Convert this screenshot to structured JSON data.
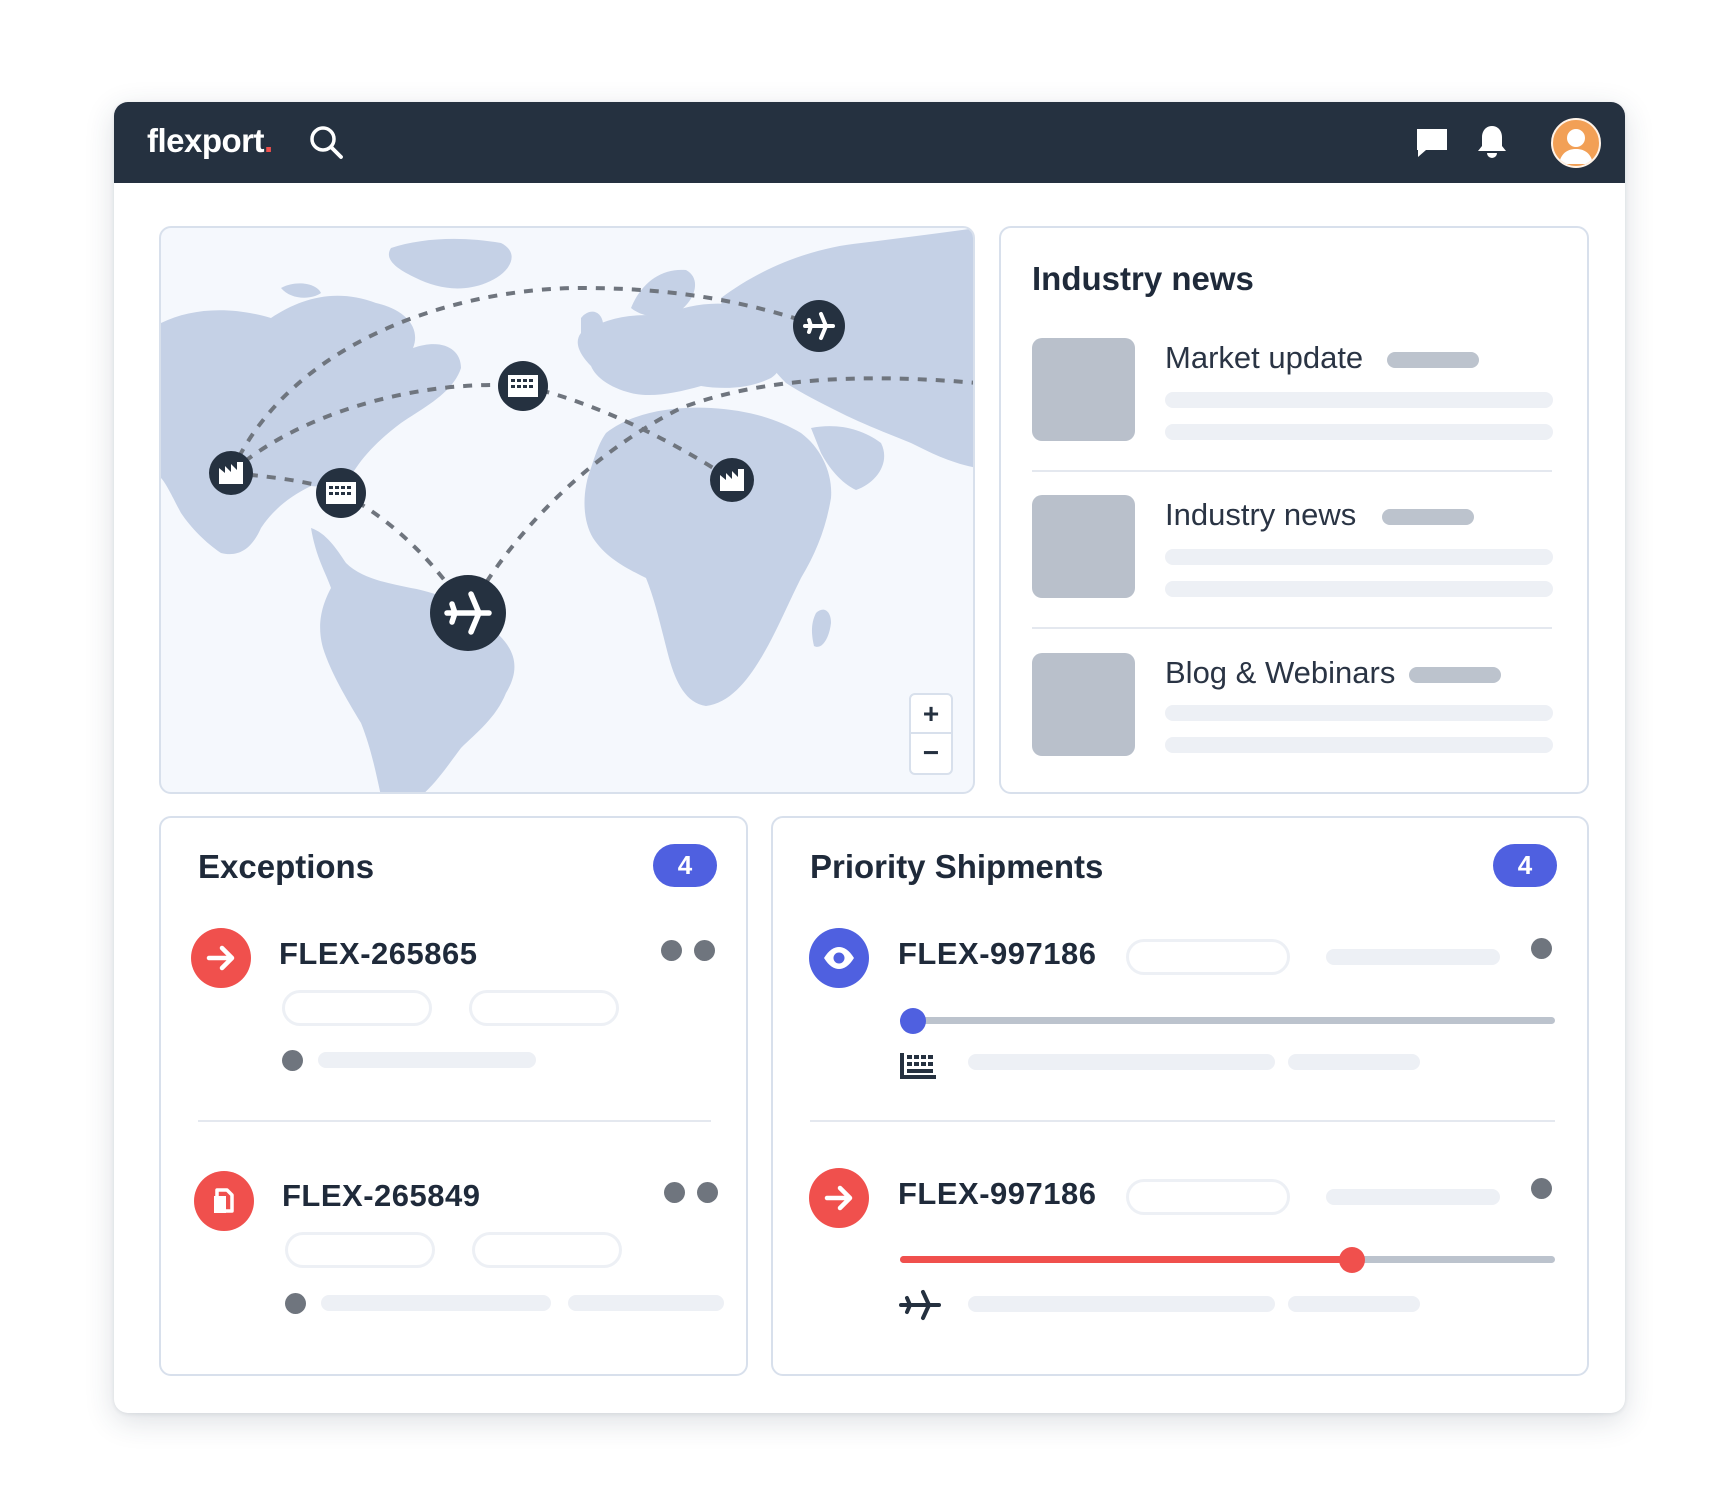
{
  "app": {
    "logo_text": "flexport",
    "logo_dot": ".",
    "icons": {
      "search": "search-icon",
      "messages": "chat-bubble-icon",
      "notifications": "bell-icon",
      "profile": "user-avatar"
    }
  },
  "map": {
    "zoom_in_label": "+",
    "zoom_out_label": "−",
    "markers": [
      "factory-icon",
      "warehouse-icon",
      "airplane-icon"
    ]
  },
  "news": {
    "title": "Industry news",
    "items": [
      {
        "label": "Market update"
      },
      {
        "label": "Industry news"
      },
      {
        "label": "Blog & Webinars"
      }
    ]
  },
  "exceptions": {
    "title": "Exceptions",
    "count": "4",
    "items": [
      {
        "id": "FLEX-265865",
        "icon": "arrow-right-icon",
        "color": "#f0504d"
      },
      {
        "id": "FLEX-265849",
        "icon": "document-icon",
        "color": "#f0504d"
      }
    ]
  },
  "priority": {
    "title": "Priority Shipments",
    "count": "4",
    "items": [
      {
        "id": "FLEX-997186",
        "icon": "eye-icon",
        "color": "#4f60e0",
        "progress": 0.02,
        "mode_icon": "warehouse-icon"
      },
      {
        "id": "FLEX-997186",
        "icon": "arrow-right-icon",
        "color": "#f0504d",
        "progress": 0.69,
        "mode_icon": "airplane-icon"
      }
    ]
  },
  "colors": {
    "topbar": "#253140",
    "accent_blue": "#4f60e0",
    "alert_red": "#f0504d",
    "map_land": "#c5d1e6",
    "map_water": "#f5f8fd"
  }
}
